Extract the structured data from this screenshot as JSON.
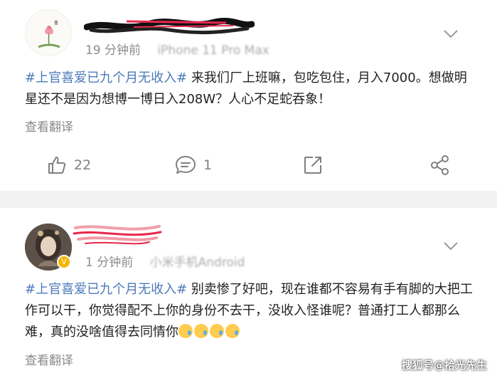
{
  "posts": [
    {
      "time": "19 分钟前",
      "device": "iPhone 11 Pro Max",
      "topic": "#上官喜爱已九个月无收入#",
      "text": " 来我们厂上班嘛，包吃包住，月入7000。想做明星还不是因为想博一博日入208W？人心不足蛇吞象！",
      "translate": "查看翻译",
      "likes": "22",
      "comments": "1"
    },
    {
      "time": "1 分钟前",
      "device": "小米手机Android",
      "topic": "#上官喜爱已九个月无收入#",
      "text": " 别卖惨了好吧，现在谁都不容易有手有脚的大把工作可以干，你觉得配不上你的身份不去干，没收入怪谁呢？普通打工人都那么难，真的没啥值得去同情你",
      "emoji_count": 4,
      "translate": "查看翻译"
    }
  ],
  "watermark": "搜狐号@拾光先生",
  "colors": {
    "topic": "#4b79b9",
    "meta": "#9a9a9a",
    "separator": "#f2f2f2",
    "icon": "#7f7f7f"
  }
}
